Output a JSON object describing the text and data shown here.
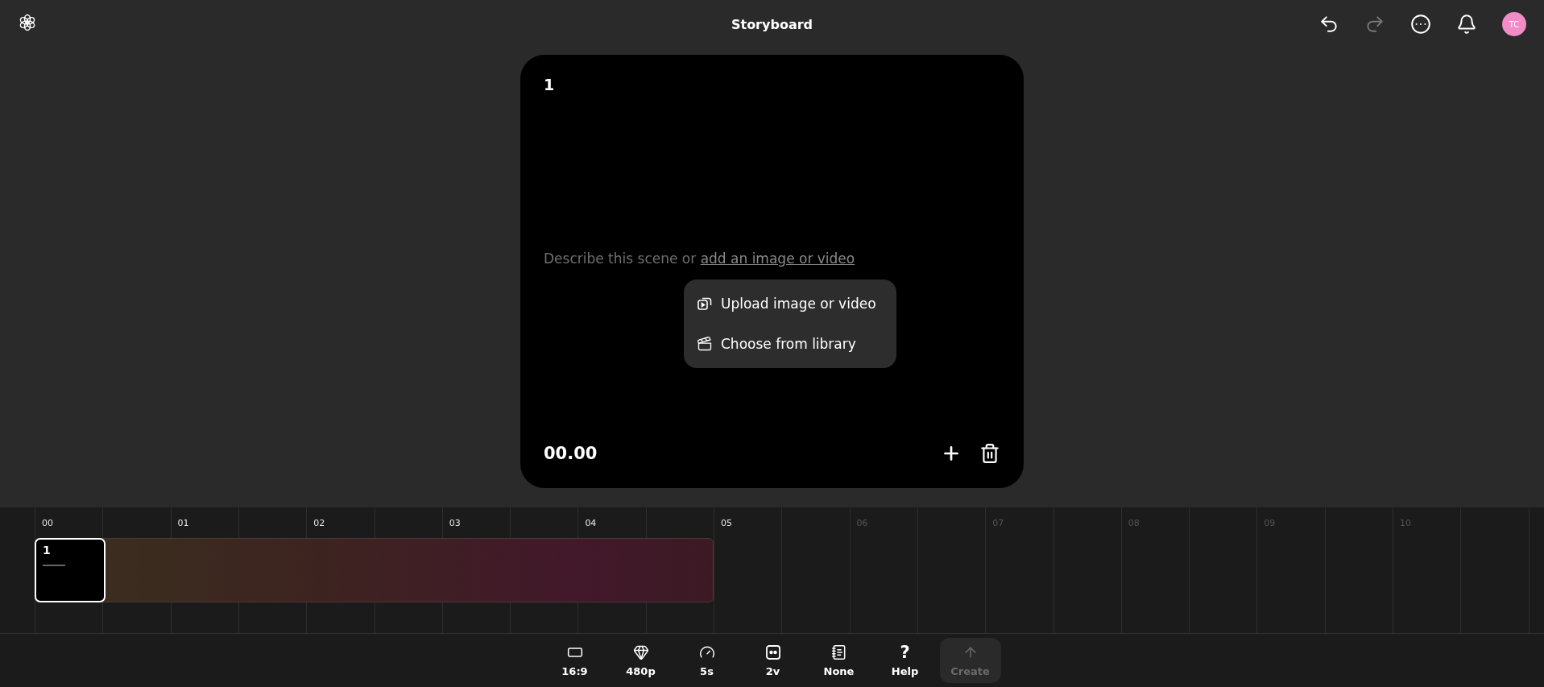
{
  "header": {
    "title": "Storyboard",
    "actions": [
      {
        "kind": "undo",
        "disabled": false
      },
      {
        "kind": "redo",
        "disabled": true
      },
      {
        "kind": "more",
        "disabled": false
      },
      {
        "kind": "bell",
        "disabled": false
      }
    ],
    "avatar": {
      "initials": "TC",
      "color": "#f08cc8"
    }
  },
  "scene": {
    "number": "1",
    "prompt_hint": "Describe this scene or ",
    "prompt_link": "add an image or video",
    "time": "00.00",
    "menu": [
      {
        "kind": "upload",
        "label": "Upload image or video"
      },
      {
        "kind": "library",
        "label": "Choose from library"
      }
    ]
  },
  "timeline": {
    "ticks": [
      {
        "label": "00",
        "in_range": true
      },
      {
        "label": "01",
        "in_range": true
      },
      {
        "label": "02",
        "in_range": true
      },
      {
        "label": "03",
        "in_range": true
      },
      {
        "label": "04",
        "in_range": true
      },
      {
        "label": "05",
        "in_range": true
      },
      {
        "label": "06",
        "in_range": false
      },
      {
        "label": "07",
        "in_range": false
      },
      {
        "label": "08",
        "in_range": false
      },
      {
        "label": "09",
        "in_range": false
      },
      {
        "label": "10",
        "in_range": false
      }
    ],
    "clips": [
      {
        "label": "1",
        "selected": true
      }
    ]
  },
  "toolbar": [
    {
      "kind": "aspect",
      "label": "16:9",
      "disabled": false
    },
    {
      "kind": "quality",
      "label": "480p",
      "disabled": false
    },
    {
      "kind": "duration",
      "label": "5s",
      "disabled": false
    },
    {
      "kind": "variations",
      "label": "2v",
      "disabled": false
    },
    {
      "kind": "preset",
      "label": "None",
      "disabled": false
    },
    {
      "kind": "help",
      "icon_text": "?",
      "label": "Help",
      "disabled": false
    },
    {
      "kind": "create",
      "label": "Create",
      "disabled": true
    }
  ]
}
